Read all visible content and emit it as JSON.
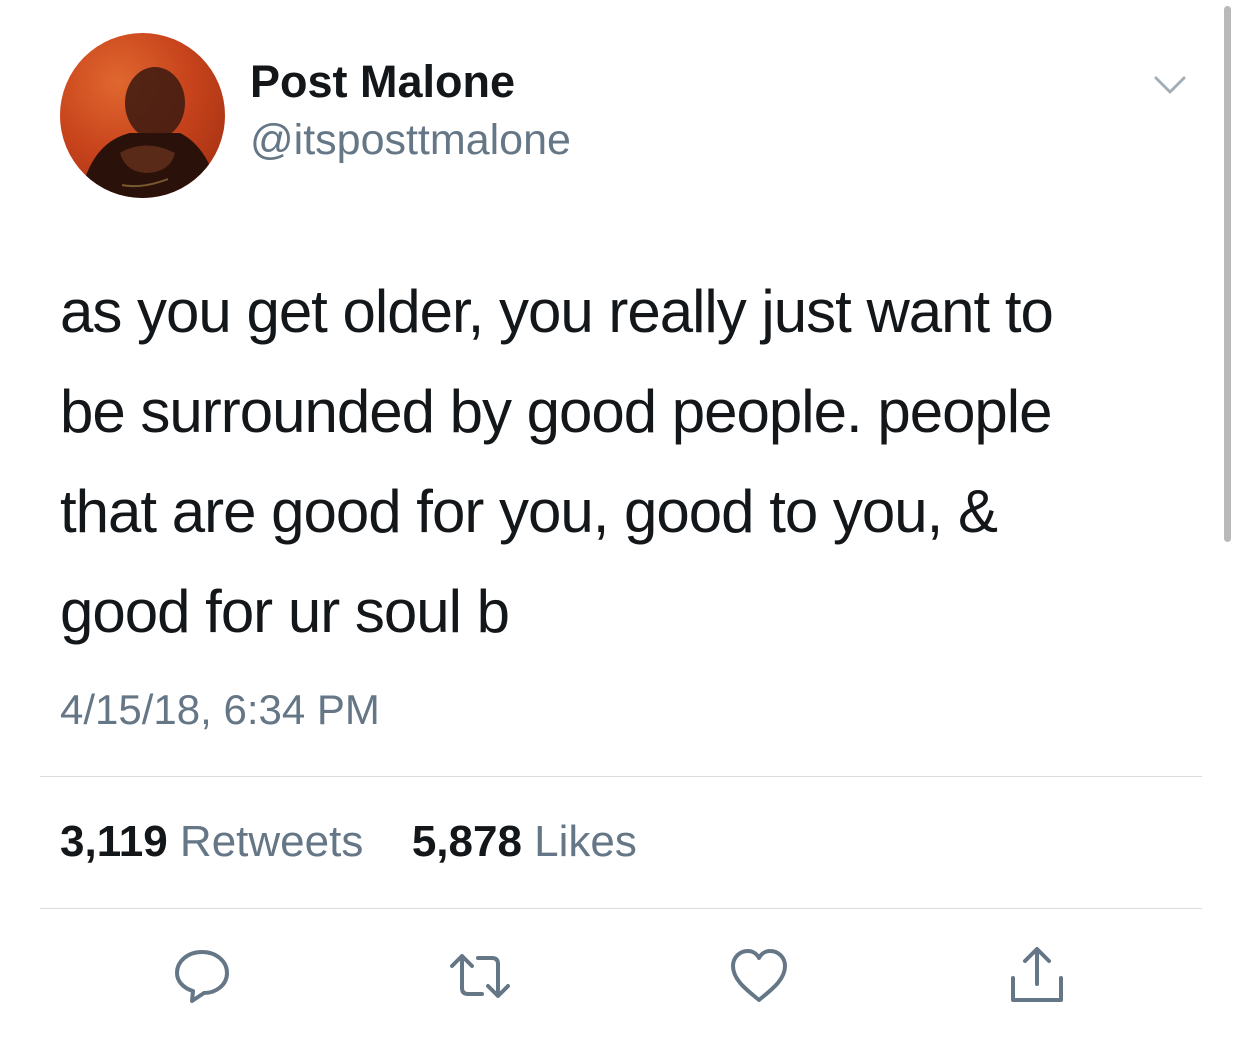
{
  "tweet": {
    "author_name": "Post Malone",
    "author_handle": "@itsposttmalone",
    "text_lines": [
      "as you get older, you really just want to",
      "be surrounded by good people. people",
      "that are good for you, good to you, &",
      "good for ur soul b"
    ],
    "timestamp": "4/15/18, 6:34 PM"
  },
  "stats": {
    "retweets_count": "3,119",
    "retweets_label": "Retweets",
    "likes_count": "5,878",
    "likes_label": "Likes"
  },
  "actions": {
    "reply_icon": "reply-icon",
    "retweet_icon": "retweet-icon",
    "like_icon": "heart-icon",
    "share_icon": "share-icon"
  },
  "colors": {
    "text_primary": "#14171a",
    "text_secondary": "#657786",
    "icon_gray": "#657786",
    "divider": "#d8dde1"
  }
}
